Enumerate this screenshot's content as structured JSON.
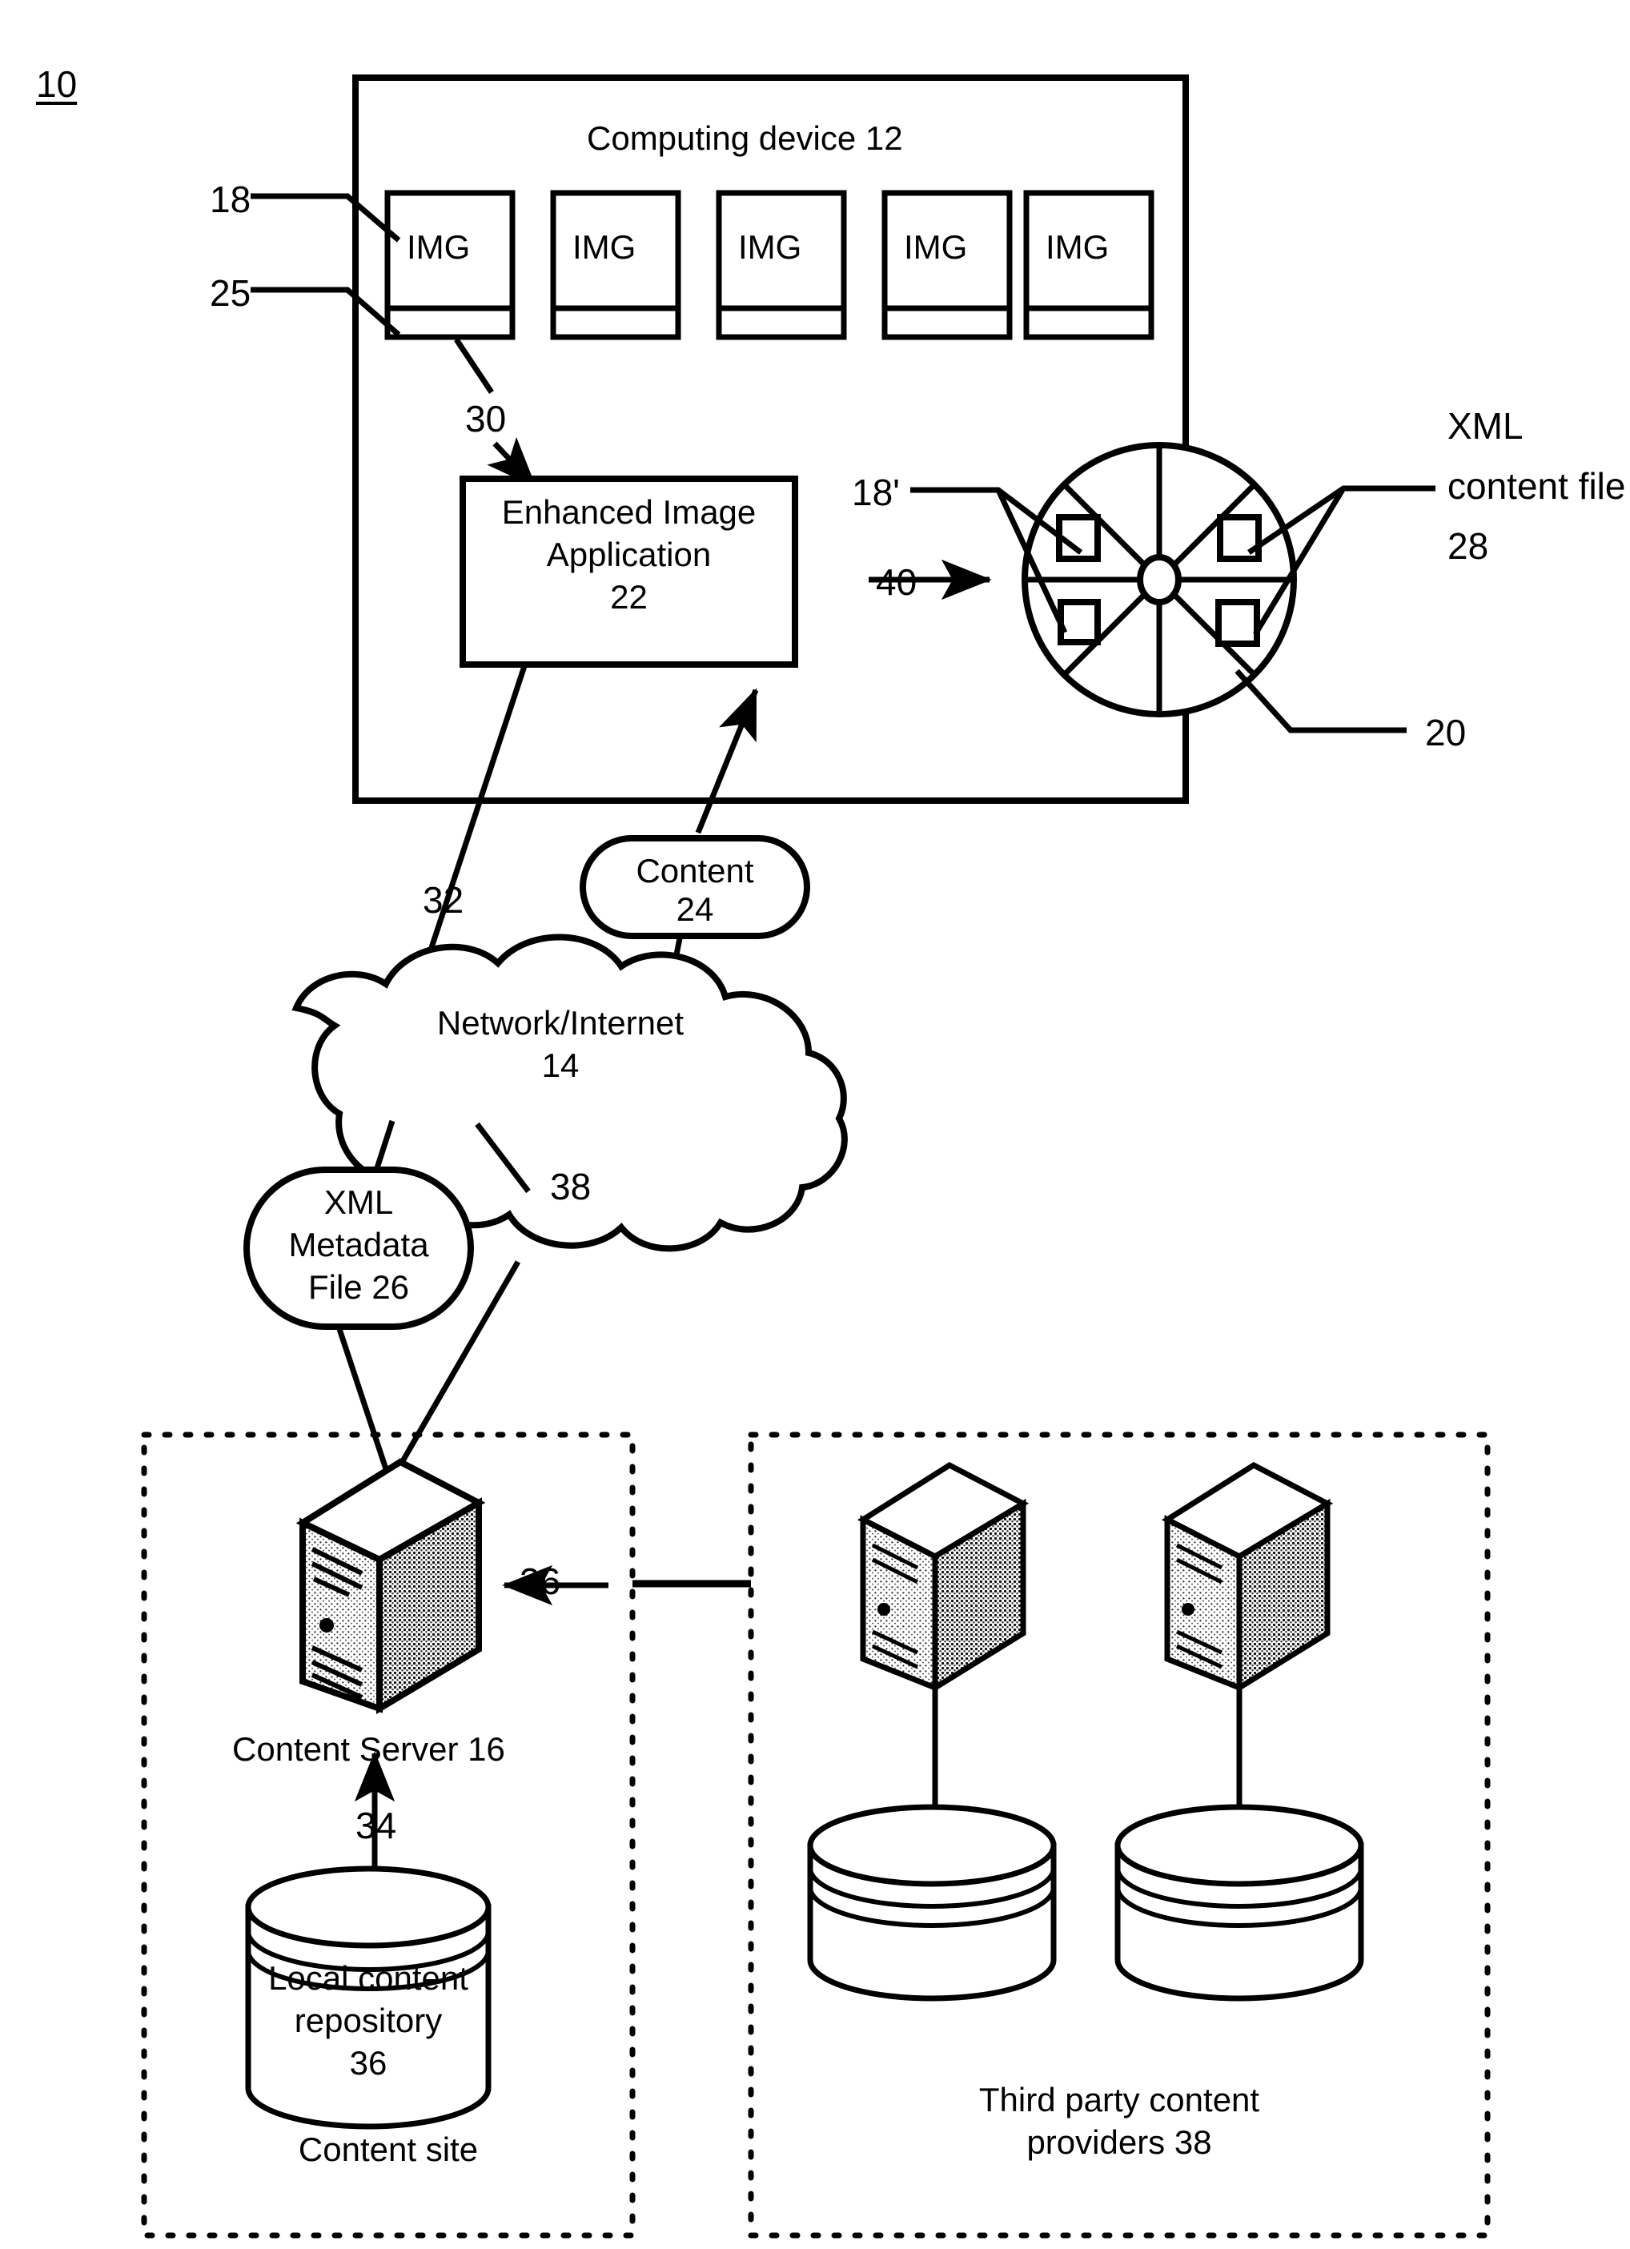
{
  "figure": {
    "number": "10",
    "type": "patent-system-diagram"
  },
  "computing_device": {
    "title": "Computing device 12",
    "image_tiles": [
      {
        "label": "IMG"
      },
      {
        "label": "IMG"
      },
      {
        "label": "IMG"
      },
      {
        "label": "IMG"
      },
      {
        "label": "IMG"
      }
    ],
    "tile_ref_top": "18",
    "tile_ref_bottom": "25",
    "arrow_to_app_ref": "30",
    "application": {
      "line1": "Enhanced Image",
      "line2": "Application",
      "line3": "22"
    },
    "wheel": {
      "inbound_arrow_ref": "40",
      "left_callout_ref": "18'",
      "right_callout_line1": "XML",
      "right_callout_line2": "content file",
      "right_callout_line3": "28",
      "bottom_callout_ref": "20",
      "spoke_count": 8,
      "square_count": 4
    }
  },
  "links": {
    "app_to_network_ref": "32",
    "content_bubble_line1": "Content",
    "content_bubble_line2": "24",
    "network_line1": "Network/Internet",
    "network_line2": "14",
    "metadata_bubble_line1": "XML",
    "metadata_bubble_line2": "Metadata",
    "metadata_bubble_line3": "File 26",
    "network_to_server_ref": "38"
  },
  "content_site": {
    "server_label": "Content Server 16",
    "server_ref": "36",
    "repo_arrow_ref": "34",
    "repository_line1": "Local content",
    "repository_line2": "repository",
    "repository_line3": "36",
    "site_label": "Content site"
  },
  "third_party": {
    "caption_line1": "Third party content",
    "caption_line2": "providers 38",
    "server_count": 2,
    "db_count": 2
  },
  "colors": {
    "ink": "#000000",
    "paper": "#ffffff"
  }
}
